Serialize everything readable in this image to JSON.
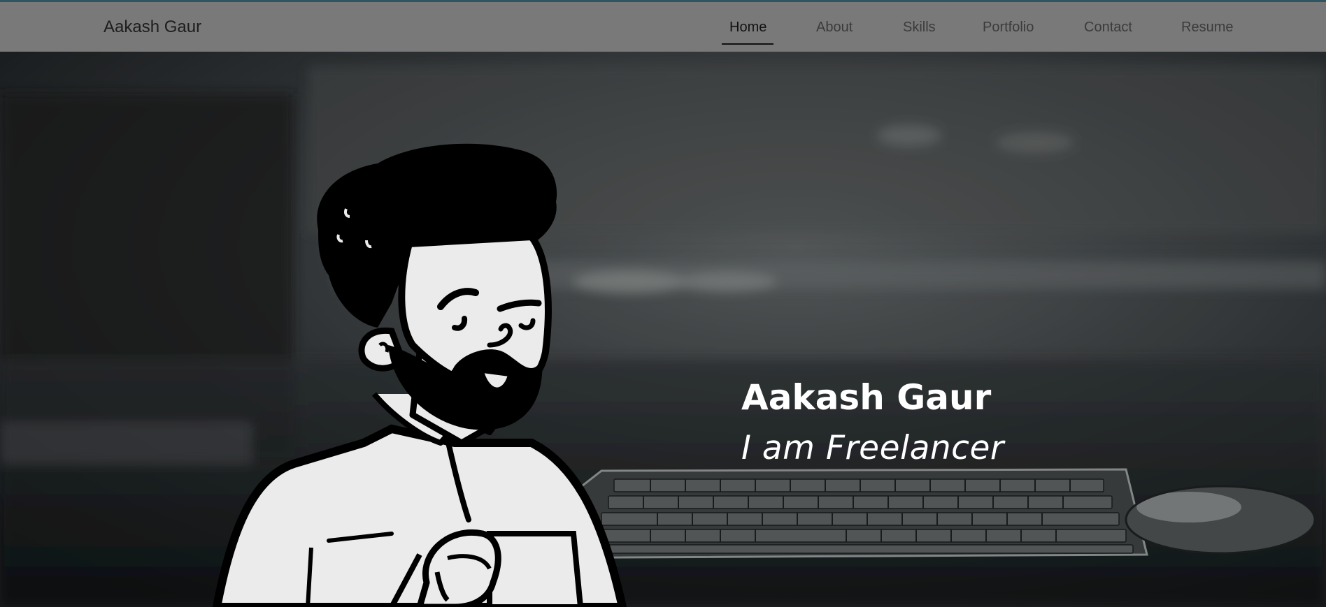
{
  "navbar": {
    "brand": "Aakash Gaur",
    "items": [
      {
        "label": "Home",
        "active": true
      },
      {
        "label": "About",
        "active": false
      },
      {
        "label": "Skills",
        "active": false
      },
      {
        "label": "Portfolio",
        "active": false
      },
      {
        "label": "Contact",
        "active": false
      },
      {
        "label": "Resume",
        "active": false
      }
    ]
  },
  "hero": {
    "name": "Aakash Gaur",
    "tagline": "I am Freelancer",
    "background": "desk-keyboard-photo",
    "illustration": "cartoon-man-holding-mug"
  },
  "colors": {
    "navbar_bg": "#797979",
    "top_accent": "#2f5560",
    "hero_text": "#ffffff"
  }
}
